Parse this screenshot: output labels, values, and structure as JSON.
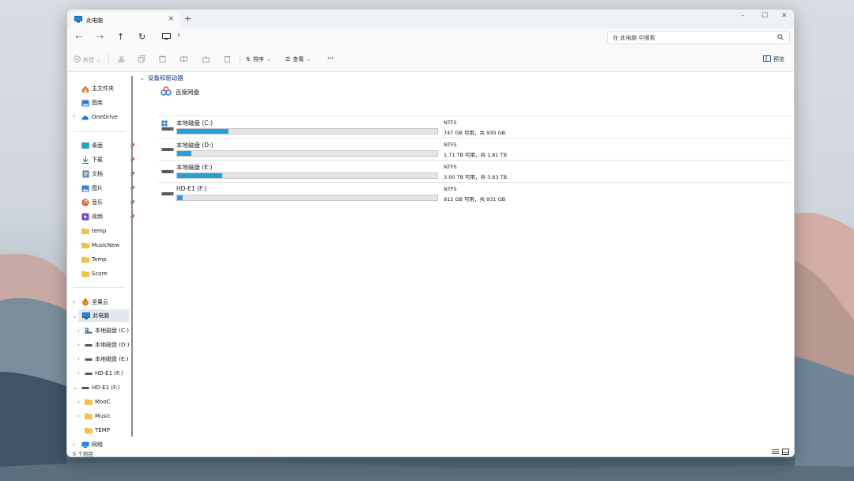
{
  "tab": {
    "title": "此电脑",
    "close": "×",
    "new": "+"
  },
  "window_controls": {
    "minimize": "–",
    "maximize": "☐",
    "close": "✕"
  },
  "nav": {
    "back": "←",
    "forward": "→",
    "up": "↑",
    "refresh": "↻",
    "chevron": "›"
  },
  "search": {
    "placeholder": "在 此电脑 中搜索"
  },
  "toolbar": {
    "new_label": "新建",
    "sort_label": "排序",
    "view_label": "查看",
    "more_label": "···",
    "preview_label": "预览"
  },
  "sidebar": {
    "home": "主文件夹",
    "gallery": "图库",
    "onedrive": "OneDrive",
    "quick": [
      {
        "label": "桌面"
      },
      {
        "label": "下载"
      },
      {
        "label": "文档"
      },
      {
        "label": "图片"
      },
      {
        "label": "音乐"
      },
      {
        "label": "视频"
      },
      {
        "label": "temp"
      },
      {
        "label": "MusicNew"
      },
      {
        "label": "Temp"
      },
      {
        "label": "Score"
      }
    ],
    "jianguo": "坚果云",
    "thispc": "此电脑",
    "pc_children": [
      {
        "label": "本地磁盘 (C:)"
      },
      {
        "label": "本地磁盘 (D:)"
      },
      {
        "label": "本地磁盘 (E:)"
      },
      {
        "label": "HD-E1 (F:)"
      }
    ],
    "hd": "HD-E1 (F:)",
    "hd_children": [
      {
        "label": "MooC"
      },
      {
        "label": "Music"
      },
      {
        "label": "TEMP"
      }
    ],
    "network": "网络"
  },
  "content": {
    "section_title": "设备和驱动器",
    "network_location": "百度网盘",
    "drives": [
      {
        "name": "本地磁盘 (C:)",
        "fs": "NTFS",
        "free_text": "747 GB 可用，共 930 GB",
        "used_fraction": 0.197
      },
      {
        "name": "本地磁盘 (D:)",
        "fs": "NTFS",
        "free_text": "1.71 TB 可用，共 1.81 TB",
        "used_fraction": 0.055
      },
      {
        "name": "本地磁盘 (E:)",
        "fs": "NTFS",
        "free_text": "3.00 TB 可用，共 3.63 TB",
        "used_fraction": 0.174
      },
      {
        "name": "HD-E1 (F:)",
        "fs": "NTFS",
        "free_text": "912 GB 可用，共 931 GB",
        "used_fraction": 0.02
      }
    ]
  },
  "status": {
    "items_count": "5 个项目"
  },
  "colors": {
    "accent": "#26a0da",
    "selection": "#e3e8ee",
    "folder": "#f5c243"
  }
}
